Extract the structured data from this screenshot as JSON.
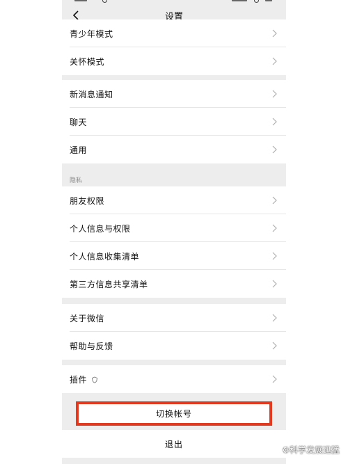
{
  "header": {
    "title": "设置"
  },
  "groups": {
    "g1": [
      "青少年模式",
      "关怀模式"
    ],
    "g2": [
      "新消息通知",
      "聊天",
      "通用"
    ],
    "privacy_label": "隐私",
    "g3": [
      "朋友权限",
      "个人信息与权限",
      "个人信息收集清单",
      "第三方信息共享清单"
    ],
    "g4": [
      "关于微信",
      "帮助与反馈"
    ],
    "g5": [
      "插件"
    ]
  },
  "actions": {
    "switch_account": "切换帐号",
    "logout": "退出"
  },
  "watermark": "科学发展迅猛",
  "colors": {
    "highlight": "#e33a1f",
    "page_bg": "#ededed"
  }
}
